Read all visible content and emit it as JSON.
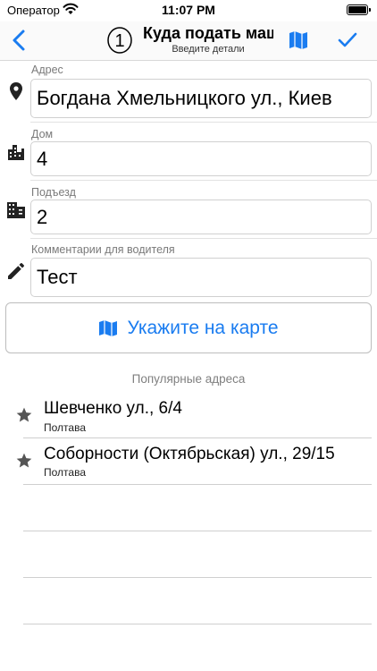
{
  "status_bar": {
    "carrier": "Оператор",
    "time": "11:07 PM"
  },
  "nav": {
    "step_number": "1",
    "title": "Куда подать машину",
    "subtitle": "Введите детали",
    "back_icon": "chevron-left-icon",
    "map_icon": "map-icon",
    "done_icon": "checkmark-icon"
  },
  "form": {
    "address": {
      "label": "Адрес",
      "value": "Богдана Хмельницкого ул., Киев",
      "icon": "location-pin-icon"
    },
    "house": {
      "label": "Дом",
      "value": "4",
      "icon": "city-buildings-icon"
    },
    "entrance": {
      "label": "Подъезд",
      "value": "2",
      "icon": "office-building-icon"
    },
    "comment": {
      "label": "Комментарии для водителя",
      "value": "Тест",
      "icon": "pencil-icon"
    }
  },
  "map_button": {
    "label": "Укажите на карте",
    "icon": "map-icon"
  },
  "popular": {
    "title": "Популярные адреса",
    "items": [
      {
        "title": "Шевченко ул., 6/4",
        "city": "Полтава",
        "icon": "star-icon"
      },
      {
        "title": "Соборности (Октябрьская) ул., 29/15",
        "city": "Полтава",
        "icon": "star-icon"
      }
    ]
  },
  "colors": {
    "accent": "#1a7cf0",
    "secondary_text": "#7a7a7a",
    "icon": "#222222"
  }
}
